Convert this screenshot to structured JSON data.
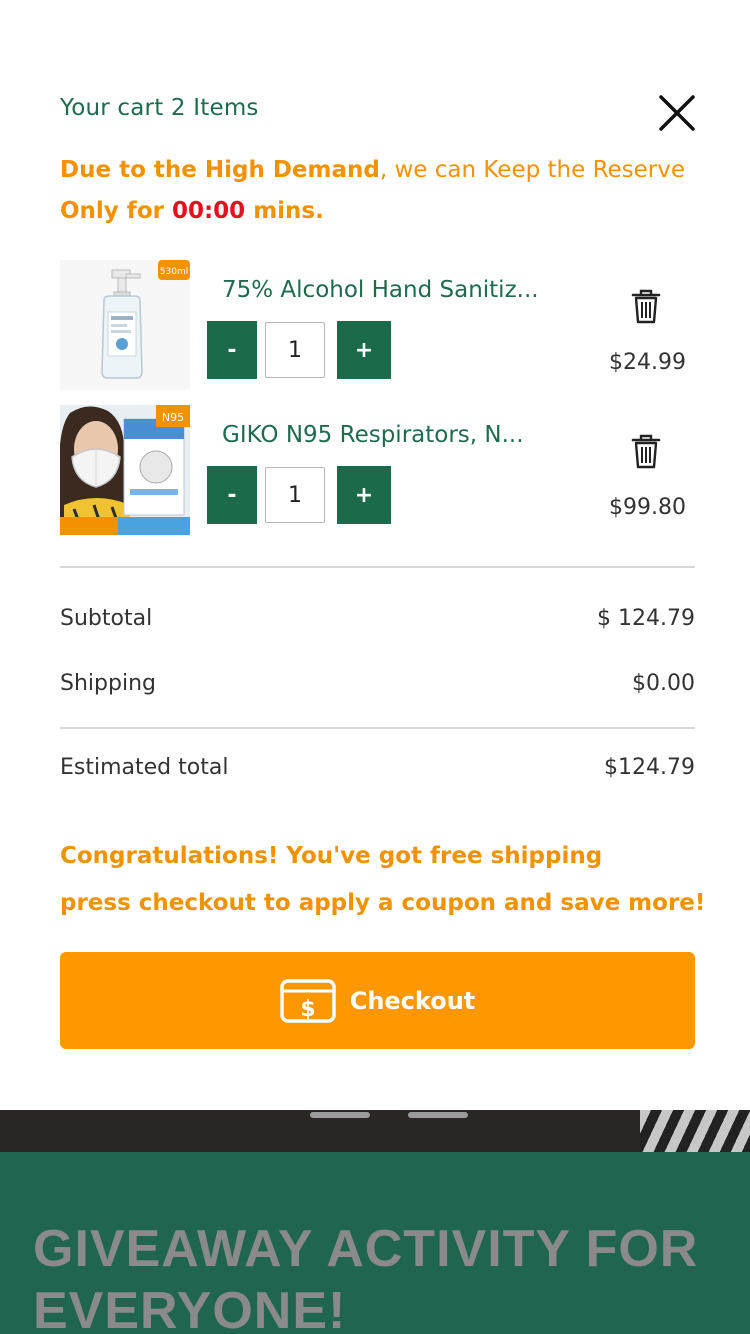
{
  "cart": {
    "title": "Your cart 2  Items",
    "notice": {
      "part1": "Due to the High Demand",
      "part2": ", we can Keep the Reserve",
      "part3": "Only for ",
      "timer": "00:00",
      "part4": " mins."
    },
    "items": [
      {
        "name": "75% Alcohol Hand Sanitiz...",
        "quantity": "1",
        "price": "$24.99",
        "minus_label": "-",
        "plus_label": "+",
        "badge": "530ml",
        "image_icon": "sanitizer-bottle"
      },
      {
        "name": "GIKO N95 Respirators, N...",
        "quantity": "1",
        "price": "$99.80",
        "minus_label": "-",
        "plus_label": "+",
        "badge": "N95",
        "image_icon": "n95-mask-woman"
      }
    ],
    "summary": {
      "subtotal_label": "Subtotal",
      "subtotal_value": "$ 124.79",
      "shipping_label": "Shipping",
      "shipping_value": "$0.00",
      "estimated_label": "Estimated total",
      "estimated_value": "$124.79"
    },
    "promo": {
      "line1": "Congratulations! You've got free shipping",
      "line2": "press checkout to apply a coupon and save more!"
    },
    "checkout": {
      "label": "Checkout",
      "icon": "payment-card-icon"
    }
  },
  "background": {
    "giveaway_title": "GIVEAWAY ACTIVITY FOR EVERYONE!"
  },
  "colors": {
    "brand_green": "#1b6b4a",
    "accent_orange": "#ff9800",
    "timer_red": "#e8101e",
    "text_orange": "#f39200"
  }
}
